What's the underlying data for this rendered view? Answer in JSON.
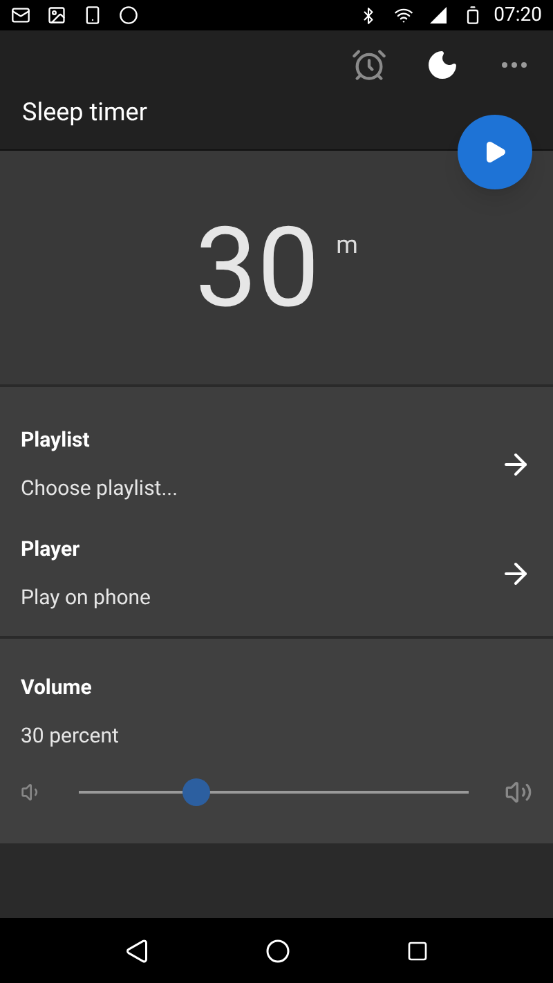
{
  "status_bar": {
    "time": "07:20"
  },
  "app_bar": {
    "title": "Sleep timer"
  },
  "timer": {
    "value": "30",
    "unit": "m"
  },
  "options": [
    {
      "label": "Playlist",
      "value": "Choose playlist..."
    },
    {
      "label": "Player",
      "value": "Play on phone"
    }
  ],
  "volume": {
    "label": "Volume",
    "reading": "30 percent",
    "level": 0.3
  }
}
